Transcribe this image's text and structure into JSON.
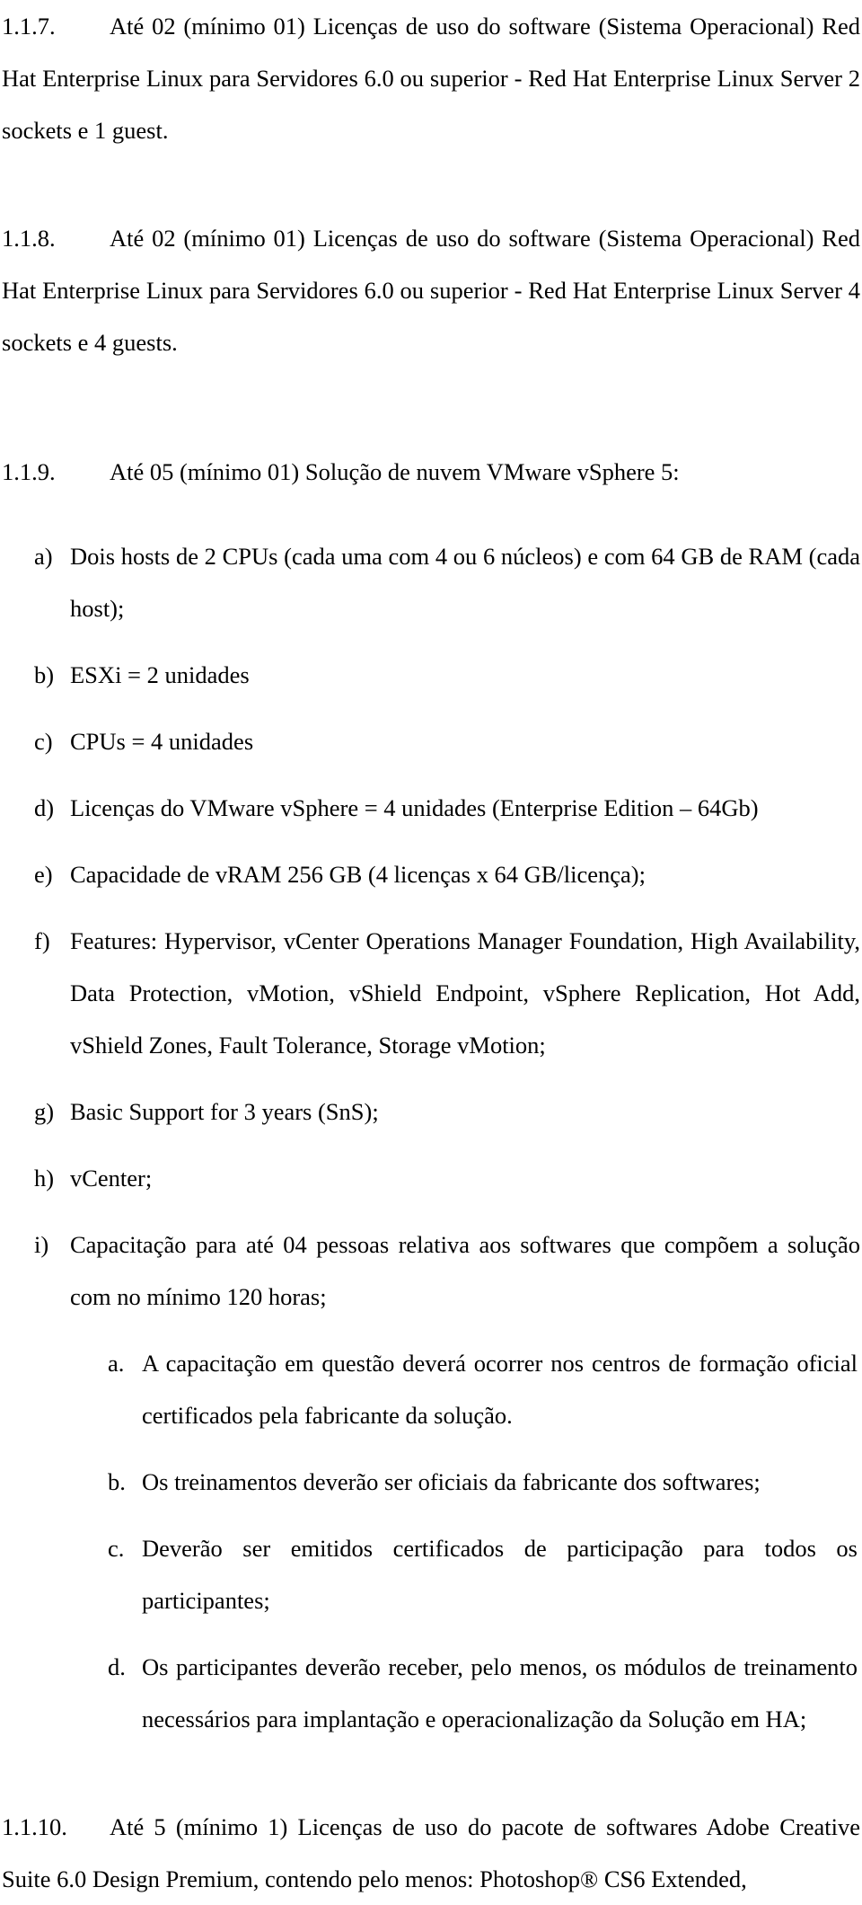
{
  "document": {
    "language": "pt-BR",
    "type": "technical-specification",
    "text_color": "#000000",
    "background_color": "#ffffff"
  },
  "clauses": [
    {
      "number": "1.1.7.",
      "text": "Até 02 (mínimo 01) Licenças de uso do software (Sistema Operacional) Red Hat Enterprise Linux para Servidores 6.0 ou superior -   Red Hat Enterprise Linux Server 2 sockets e 1 guest."
    },
    {
      "number": "1.1.8.",
      "text": "Até 02 (mínimo 01) Licenças de uso do software (Sistema Operacional) Red Hat Enterprise Linux para Servidores 6.0 ou superior -   Red Hat Enterprise Linux Server 4 sockets e 4 guests."
    },
    {
      "number": "1.1.9.",
      "text": "Até 05 (mínimo 01) Solução de nuvem VMware vSphere 5:"
    },
    {
      "number": "1.1.10.",
      "text": "Até 5 (mínimo 1) Licenças de uso do pacote de softwares Adobe Creative Suite 6.0 Design Premium, contendo pelo menos: Photoshop® CS6 Extended,"
    }
  ],
  "vsphere_items": [
    {
      "marker": "a)",
      "text": "Dois hosts de 2 CPUs (cada uma com 4 ou 6 núcleos) e com 64 GB de RAM (cada host);"
    },
    {
      "marker": "b)",
      "text": "ESXi = 2 unidades"
    },
    {
      "marker": "c)",
      "text": "CPUs = 4 unidades"
    },
    {
      "marker": "d)",
      "text": "Licenças do VMware vSphere = 4 unidades (Enterprise Edition – 64Gb)"
    },
    {
      "marker": "e)",
      "text": "Capacidade de vRAM 256 GB (4 licenças x 64 GB/licença);"
    },
    {
      "marker": "f)",
      "text": "Features: Hypervisor, vCenter Operations Manager Foundation, High Availability, Data Protection, vMotion, vShield Endpoint, vSphere Replication, Hot Add, vShield Zones, Fault Tolerance, Storage vMotion;"
    },
    {
      "marker": "g)",
      "text": "Basic Support for 3 years (SnS);"
    },
    {
      "marker": "h)",
      "text": "vCenter;"
    },
    {
      "marker": "i)",
      "text": "Capacitação para até 04 pessoas relativa aos softwares que compõem a solução com no mínimo 120 horas;"
    }
  ],
  "training_subitems": [
    {
      "marker": "a.",
      "text": "A capacitação em questão deverá ocorrer nos centros de formação oficial certificados pela fabricante da solução."
    },
    {
      "marker": "b.",
      "text": "Os treinamentos deverão ser oficiais da fabricante dos softwares;"
    },
    {
      "marker": "c.",
      "text": "Deverão ser emitidos certificados de participação para todos os participantes;"
    },
    {
      "marker": "d.",
      "text": "Os participantes deverão receber, pelo menos, os módulos de treinamento necessários para implantação e operacionalização da Solução em HA;"
    }
  ]
}
